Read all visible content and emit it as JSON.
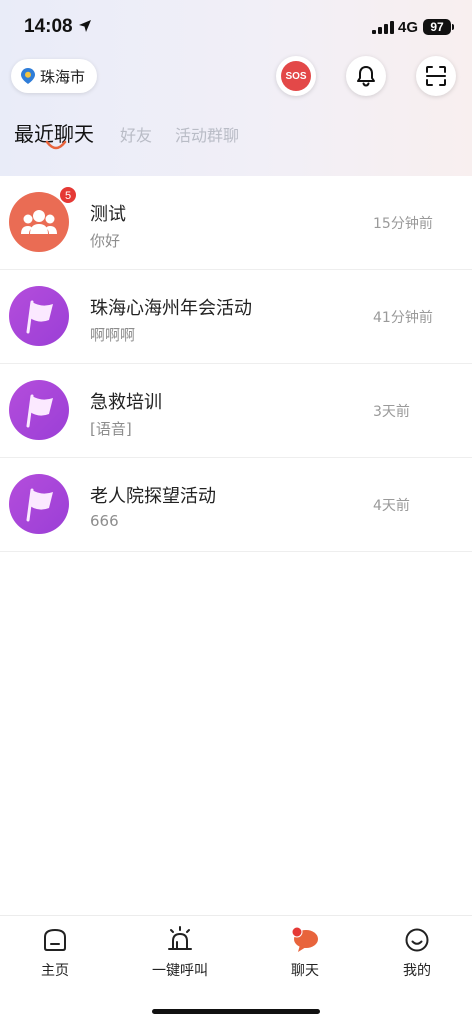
{
  "status_bar": {
    "time": "14:08",
    "network": "4G",
    "battery": "97"
  },
  "header": {
    "city": "珠海市",
    "sos_label": "SOS"
  },
  "tabs": [
    {
      "label": "最近聊天",
      "active": true
    },
    {
      "label": "好友",
      "active": false
    },
    {
      "label": "活动群聊",
      "active": false
    }
  ],
  "chats": [
    {
      "name": "测试",
      "preview": "你好",
      "time": "15分钟前",
      "unread": "5",
      "avatar": "group-icon"
    },
    {
      "name": "珠海心海州年会活动",
      "preview": "啊啊啊",
      "time": "41分钟前",
      "avatar": "flag-icon"
    },
    {
      "name": "急救培训",
      "preview": "[语音]",
      "time": "3天前",
      "avatar": "flag-icon"
    },
    {
      "name": "老人院探望活动",
      "preview": "666",
      "time": "4天前",
      "avatar": "flag-icon"
    }
  ],
  "nav": [
    {
      "label": "主页",
      "icon": "home-icon"
    },
    {
      "label": "一键呼叫",
      "icon": "alarm-icon"
    },
    {
      "label": "聊天",
      "icon": "chat-icon",
      "active": true
    },
    {
      "label": "我的",
      "icon": "profile-icon"
    }
  ],
  "colors": {
    "accent": "#e8643c",
    "sos": "#e34848",
    "badge": "#e53935",
    "avatar_purple": "#a845d9",
    "avatar_orange": "#ea6c54"
  }
}
